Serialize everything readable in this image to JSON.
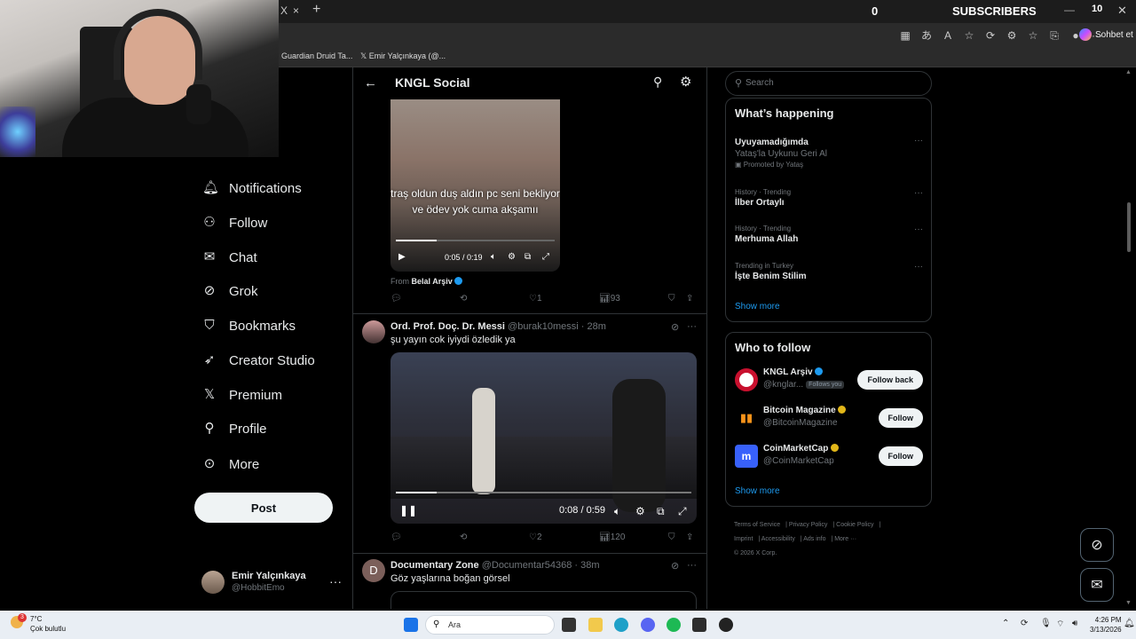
{
  "browser": {
    "tab_close": "×",
    "tab_x": "X",
    "new_tab": "+",
    "subscriber_count": "0",
    "subscriber_label": "SUBSCRIBERS",
    "window_max": "10",
    "copilot_label": "Sohbet et",
    "bookmarks": [
      "Guardian Druid Ta...",
      "Emir Yalçınkaya (@..."
    ]
  },
  "nav": {
    "items": [
      {
        "label": "Notifications",
        "icon": "bell-icon"
      },
      {
        "label": "Follow",
        "icon": "person-add-icon"
      },
      {
        "label": "Chat",
        "icon": "mail-icon"
      },
      {
        "label": "Grok",
        "icon": "grok-icon"
      },
      {
        "label": "Bookmarks",
        "icon": "bookmark-icon"
      },
      {
        "label": "Creator Studio",
        "icon": "rocket-icon"
      },
      {
        "label": "Premium",
        "icon": "x-logo-icon"
      },
      {
        "label": "Profile",
        "icon": "person-icon"
      },
      {
        "label": "More",
        "icon": "more-circle-icon"
      }
    ],
    "post_label": "Post",
    "account": {
      "name": "Emir Yalçınkaya",
      "handle": "@HobbitEmo",
      "more": "···"
    }
  },
  "main": {
    "title": "KNGL Social",
    "tweet1": {
      "caption": "traş oldun duş aldın pc seni bekliyor ve ödev yok cuma akşamıı",
      "time": "0:05 / 0:19",
      "from_label": "From",
      "from_name": "Belal Arşiv",
      "likes": "1",
      "views": "93"
    },
    "tweet2": {
      "author": "Ord. Prof. Doç. Dr. Messi",
      "handle": "@burak10messi",
      "age": "28m",
      "text": "şu yayın cok iyiydi özledik ya",
      "time": "0:08 / 0:59",
      "likes": "2",
      "views": "120"
    },
    "tweet3": {
      "initial": "D",
      "author": "Documentary Zone",
      "handle": "@Documentar54368",
      "age": "38m",
      "text": "Göz yaşlarına boğan görsel"
    }
  },
  "sidebar": {
    "search_placeholder": "Search",
    "happening_title": "What’s happening",
    "trends": [
      {
        "meta": "",
        "name": "Uyuyamadığımda",
        "sub": "Yataş'la Uykunu Geri Al",
        "promo": "Promoted by Yataş"
      },
      {
        "meta": "History · Trending",
        "name": "İlber Ortaylı",
        "sub": "",
        "promo": ""
      },
      {
        "meta": "History · Trending",
        "name": "Merhuma Allah",
        "sub": "",
        "promo": ""
      },
      {
        "meta": "Trending in Turkey",
        "name": "İşte Benim Stilim",
        "sub": "",
        "promo": ""
      }
    ],
    "show_more": "Show more",
    "who_title": "Who to follow",
    "who": [
      {
        "name": "KNGL Arşiv",
        "handle": "@knglar...",
        "follows_you": "Follows you",
        "button": "Follow back",
        "badge": "blue",
        "color": "#c8102e"
      },
      {
        "name": "Bitcoin Magazine",
        "handle": "@BitcoinMagazine",
        "follows_you": "",
        "button": "Follow",
        "badge": "gold",
        "color": "#000000"
      },
      {
        "name": "CoinMarketCap",
        "handle": "@CoinMarketCap",
        "follows_you": "",
        "button": "Follow",
        "badge": "gold",
        "color": "#3861fb"
      }
    ],
    "footer": [
      "Terms of Service",
      "Privacy Policy",
      "Cookie Policy",
      "Imprint",
      "Accessibility",
      "Ads info",
      "More ···",
      "© 2026 X Corp."
    ]
  },
  "taskbar": {
    "weather_badge": "3",
    "temp": "7°C",
    "condition": "Çok bulutlu",
    "search_label": "Ara",
    "time": "4:26 PM",
    "date": "3/13/2026"
  },
  "colors": {
    "accent": "#1d9bf0",
    "bg": "#000000",
    "text": "#e7e9ea",
    "muted": "#71767b"
  }
}
